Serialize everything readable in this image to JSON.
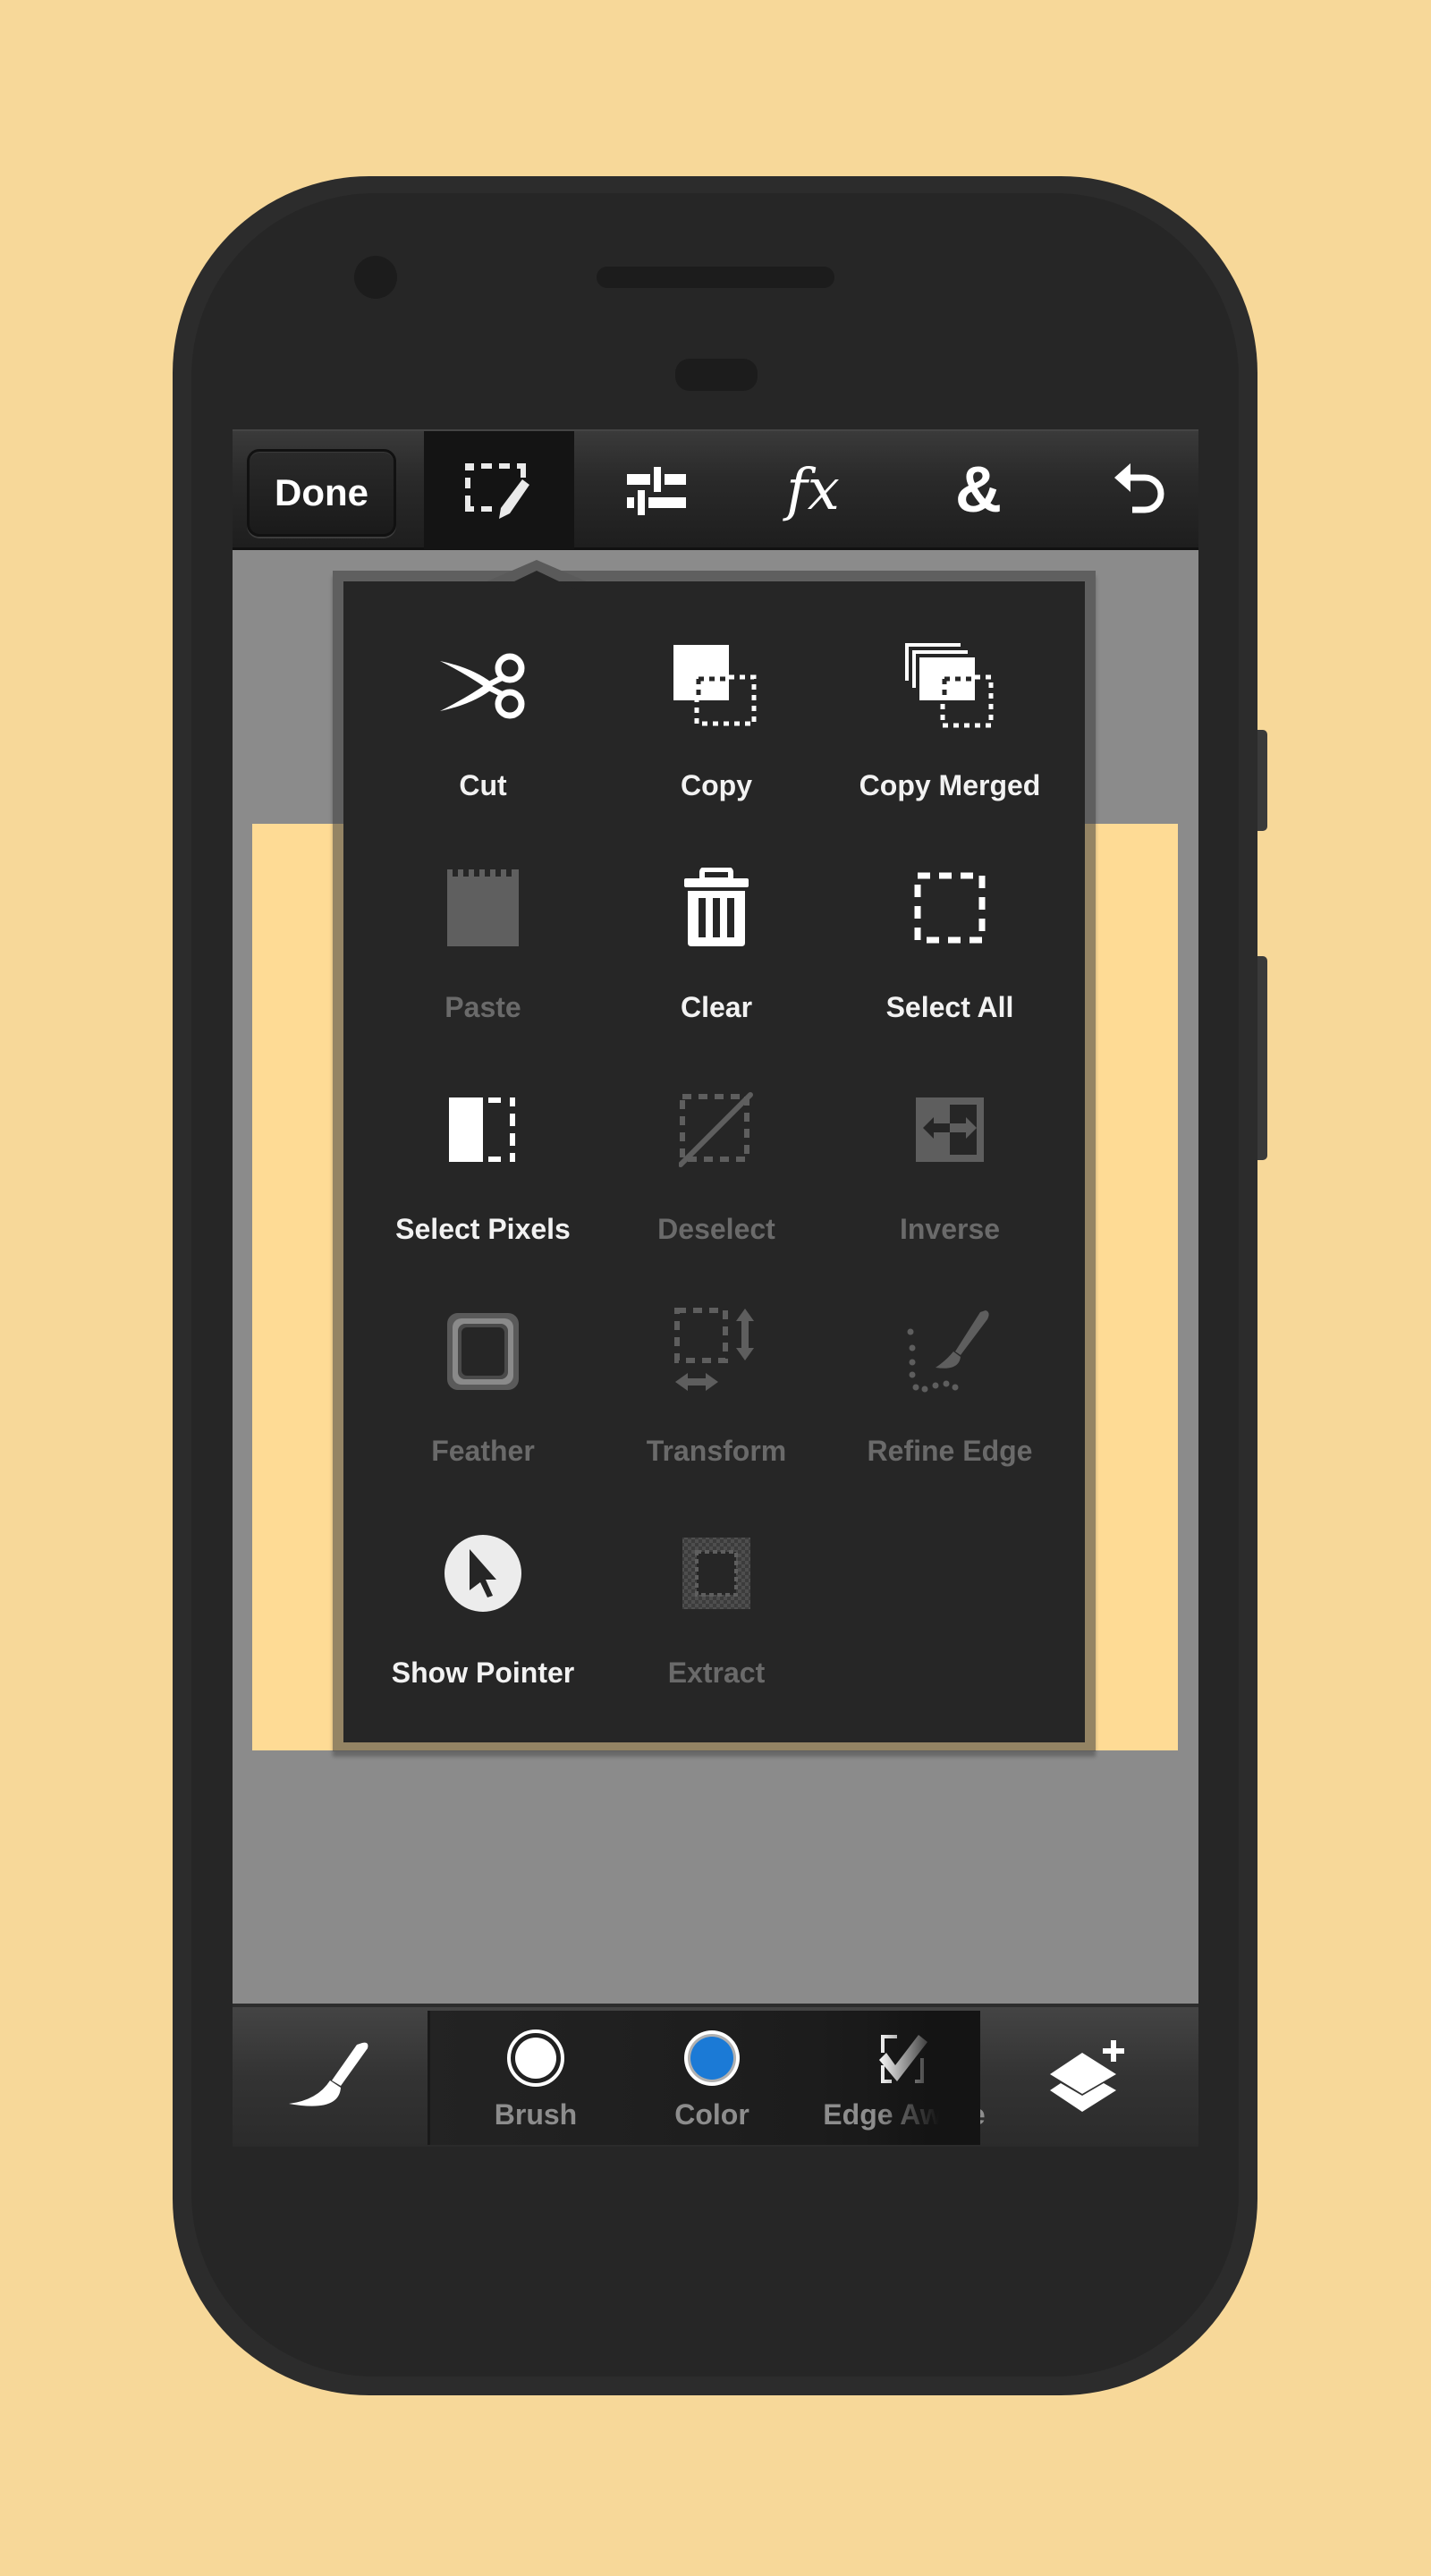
{
  "toolbar": {
    "done_label": "Done",
    "tabs": [
      {
        "name": "selection-tools",
        "icon": "selection-edit-icon",
        "selected": true
      },
      {
        "name": "adjustments",
        "icon": "sliders-icon",
        "selected": false
      },
      {
        "name": "effects",
        "icon": "fx-icon",
        "glyph": "fx",
        "selected": false
      },
      {
        "name": "blend",
        "icon": "ampersand-icon",
        "glyph": "&",
        "selected": false
      },
      {
        "name": "undo",
        "icon": "undo-icon",
        "selected": false
      }
    ]
  },
  "selection_menu": {
    "items": [
      {
        "label": "Cut",
        "icon": "scissors-icon",
        "enabled": true
      },
      {
        "label": "Copy",
        "icon": "copy-icon",
        "enabled": true
      },
      {
        "label": "Copy Merged",
        "icon": "copy-merged-icon",
        "enabled": true
      },
      {
        "label": "Paste",
        "icon": "paste-icon",
        "enabled": false
      },
      {
        "label": "Clear",
        "icon": "trash-icon",
        "enabled": true
      },
      {
        "label": "Select All",
        "icon": "select-all-icon",
        "enabled": true
      },
      {
        "label": "Select Pixels",
        "icon": "select-pixels-icon",
        "enabled": true
      },
      {
        "label": "Deselect",
        "icon": "deselect-icon",
        "enabled": false
      },
      {
        "label": "Inverse",
        "icon": "inverse-icon",
        "enabled": false
      },
      {
        "label": "Feather",
        "icon": "feather-icon",
        "enabled": false
      },
      {
        "label": "Transform",
        "icon": "transform-icon",
        "enabled": false
      },
      {
        "label": "Refine Edge",
        "icon": "refine-edge-icon",
        "enabled": false
      },
      {
        "label": "Show Pointer",
        "icon": "pointer-icon",
        "enabled": true
      },
      {
        "label": "Extract",
        "icon": "extract-icon",
        "enabled": false
      }
    ]
  },
  "bottom_bar": {
    "tool": "brush-tool",
    "options": [
      {
        "label": "Brush",
        "icon": "brush-size-icon"
      },
      {
        "label": "Color",
        "icon": "color-swatch-icon",
        "color": "#1b7ad6"
      },
      {
        "label": "Edge Aware",
        "icon": "checkbox-checked-icon",
        "checked": true
      }
    ],
    "layers_button": "add-layer-icon"
  },
  "colors": {
    "background": "#f7d899",
    "canvas": "#fedb95",
    "workspace": "#8b8b8b",
    "accent_color_swatch": "#1b7ad6"
  }
}
